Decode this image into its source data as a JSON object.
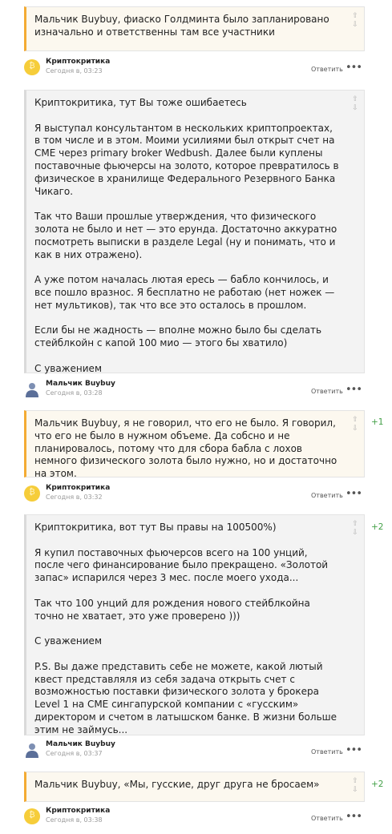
{
  "comments": [
    {
      "paragraphs": [
        "Мальчик Buybuy, фиаско Голдминта было запланировано изначально и ответственны там все участники"
      ],
      "score": "",
      "author": "Криптокритика",
      "time": "Сегодня в, 03:23",
      "reply": "Ответить"
    },
    {
      "paragraphs": [
        "Криптокритика, тут Вы тоже ошибаетесь",
        "Я выступал консультантом в нескольких криптопроектах, в том числе и в этом. Моими усилиями был открыт счет на CME через primary broker Wedbush. Далее были куплены поставочные фьючерсы на золото, которое превратилось в физическое в хранилище Федерального Резервного Банка Чикаго.",
        "Так что Ваши прошлые утверждения, что физического золота не было и нет — это ерунда. Достаточно аккуратно посмотреть выписки в разделе Legal (ну и понимать, что и как в них отражено).",
        "А уже потом началась лютая ересь — бабло кончилось, и все пошло вразнос. Я бесплатно не работаю (нет ножек — нет мультиков), так что все это осталось в прошлом.",
        "Если бы не жадность — вполне можно было бы сделать стейблкойн с капой 100 мио — этого бы хватило)",
        "С уважением"
      ],
      "score": "",
      "author": "Мальчик Buybuy",
      "time": "Сегодня в, 03:28",
      "reply": "Ответить"
    },
    {
      "paragraphs": [
        "Мальчик Buybuy, я не говорил, что его не было. Я говорил, что его не было в нужном объеме. Да собсно и не планировалось, потому что для сбора бабла с лохов немного физического золота было нужно, но и достаточно на этом."
      ],
      "score": "+1",
      "author": "Криптокритика",
      "time": "Сегодня в, 03:32",
      "reply": "Ответить"
    },
    {
      "paragraphs": [
        "Криптокритика, вот тут Вы правы на 100500%)",
        "Я купил поставочных фьючерсов всего на 100 унций, после чего финансирование было прекращено. «Золотой запас» испарился через 3 мес. после моего ухода...",
        "Так что 100 унций для рождения нового стейблкойна точно не хватает, это уже проверено )))",
        "С уважением",
        "P.S. Вы даже представить себе не можете, какой лютый квест представляля из себя задача открыть счет с возможностью поставки физического золота у брокера Level 1 на CME сингапурской компании с «гусским» директором и счетом в латышском банке. В жизни больше этим не займусь..."
      ],
      "score": "+2",
      "author": "Мальчик Buybuy",
      "time": "Сегодня в, 03:37",
      "reply": "Ответить"
    },
    {
      "paragraphs": [
        "Мальчик Buybuy, «Мы, гусские, друг друга не бросаем»"
      ],
      "score": "+2",
      "author": "Криптокритика",
      "time": "Сегодня в, 03:38",
      "reply": "Ответить"
    }
  ],
  "icons": {
    "arrows": "vote-arrows-icon",
    "more": "more-dots-icon",
    "crypto_avatar": "bitcoin-coin-avatar",
    "user_avatar": "user-silhouette-avatar"
  },
  "colors": {
    "yellow_bg": "#fcf8ef",
    "yellow_border": "#f4ab34",
    "gray_bg": "#f3f3f3",
    "score_green": "#43a047",
    "coin": "#f6cd3a"
  }
}
